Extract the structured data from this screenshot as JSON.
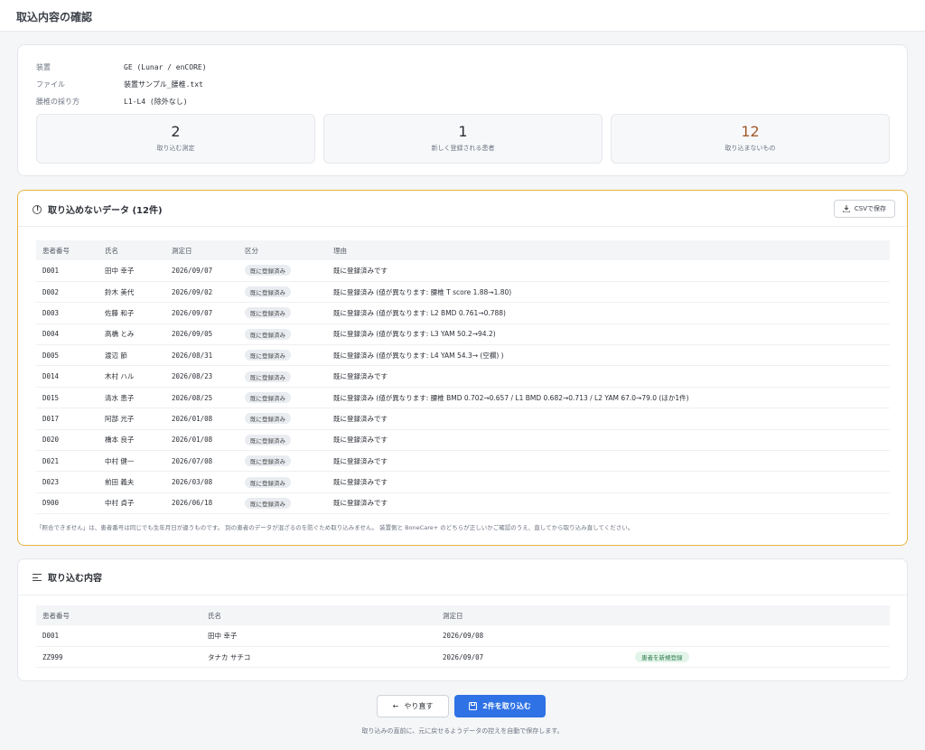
{
  "page_title": "取込内容の確認",
  "summary": {
    "fields": [
      {
        "key": "装置",
        "value": "GE (Lunar / enCORE)"
      },
      {
        "key": "ファイル",
        "value": "装置サンプル_腰椎.txt"
      },
      {
        "key": "腰椎の採り方",
        "value": "L1-L4 (除外なし)"
      }
    ],
    "stats": [
      {
        "value": "2",
        "label": "取り込む測定"
      },
      {
        "value": "1",
        "label": "新しく登録される患者"
      },
      {
        "value": "12",
        "label": "取り込まないもの"
      }
    ]
  },
  "errors": {
    "title": "取り込めないデータ (12件)",
    "csv_label": "CSVで保存",
    "columns": [
      "患者番号",
      "氏名",
      "測定日",
      "区分",
      "理由"
    ],
    "rows": [
      {
        "id": "D001",
        "name": "田中 幸子",
        "date": "2026/09/07",
        "kind": "既に登録済み",
        "reason": "既に登録済みです"
      },
      {
        "id": "D002",
        "name": "鈴木 美代",
        "date": "2026/09/02",
        "kind": "既に登録済み",
        "reason": "既に登録済み (値が異なります: 腰椎 T score 1.88→1.80)"
      },
      {
        "id": "D003",
        "name": "佐藤 和子",
        "date": "2026/09/07",
        "kind": "既に登録済み",
        "reason": "既に登録済み (値が異なります: L2 BMD 0.761→0.788)"
      },
      {
        "id": "D004",
        "name": "高橋 とみ",
        "date": "2026/09/05",
        "kind": "既に登録済み",
        "reason": "既に登録済み (値が異なります: L3 YAM 50.2→94.2)"
      },
      {
        "id": "D005",
        "name": "渡辺 節",
        "date": "2026/08/31",
        "kind": "既に登録済み",
        "reason": "既に登録済み (値が異なります: L4 YAM 54.3→ (空欄) )"
      },
      {
        "id": "D014",
        "name": "木村 ハル",
        "date": "2026/08/23",
        "kind": "既に登録済み",
        "reason": "既に登録済みです"
      },
      {
        "id": "D015",
        "name": "清水 恵子",
        "date": "2026/08/25",
        "kind": "既に登録済み",
        "reason": "既に登録済み (値が異なります: 腰椎 BMD 0.702→0.657 / L1 BMD 0.682→0.713 / L2 YAM 67.0→79.0 (ほか1件)"
      },
      {
        "id": "D017",
        "name": "阿部 光子",
        "date": "2026/01/08",
        "kind": "既に登録済み",
        "reason": "既に登録済みです"
      },
      {
        "id": "D020",
        "name": "橋本 良子",
        "date": "2026/01/08",
        "kind": "既に登録済み",
        "reason": "既に登録済みです"
      },
      {
        "id": "D021",
        "name": "中村 健一",
        "date": "2026/07/08",
        "kind": "既に登録済み",
        "reason": "既に登録済みです"
      },
      {
        "id": "D023",
        "name": "前田 義夫",
        "date": "2026/03/08",
        "kind": "既に登録済み",
        "reason": "既に登録済みです"
      },
      {
        "id": "D900",
        "name": "中村 貞子",
        "date": "2026/06/18",
        "kind": "既に登録済み",
        "reason": "既に登録済みです"
      }
    ],
    "note": "「照合できません」は、患者番号は同じでも生年月日が違うものです。 別の患者のデータが混ざるのを防ぐため取り込みません。 装置側と BoneCare+ のどちらが正しいかご確認のうえ、直してから取り込み直してください。"
  },
  "imports": {
    "title": "取り込む内容",
    "columns": [
      "患者番号",
      "氏名",
      "測定日",
      ""
    ],
    "rows": [
      {
        "id": "D001",
        "name": "田中 幸子",
        "date": "2026/09/08",
        "badge": ""
      },
      {
        "id": "ZZ999",
        "name": "タナカ サチコ",
        "date": "2026/09/07",
        "badge": "患者を新規登録"
      }
    ]
  },
  "actions": {
    "back_label": "やり直す",
    "import_label": "2件を取り込む",
    "footnote": "取り込みの直前に、元に戻せるようデータの控えを自動で保存します。"
  },
  "colors": {
    "accent": "#2f72e5",
    "warning_border": "#e8b33f",
    "new_badge": "#e3f5ea"
  }
}
